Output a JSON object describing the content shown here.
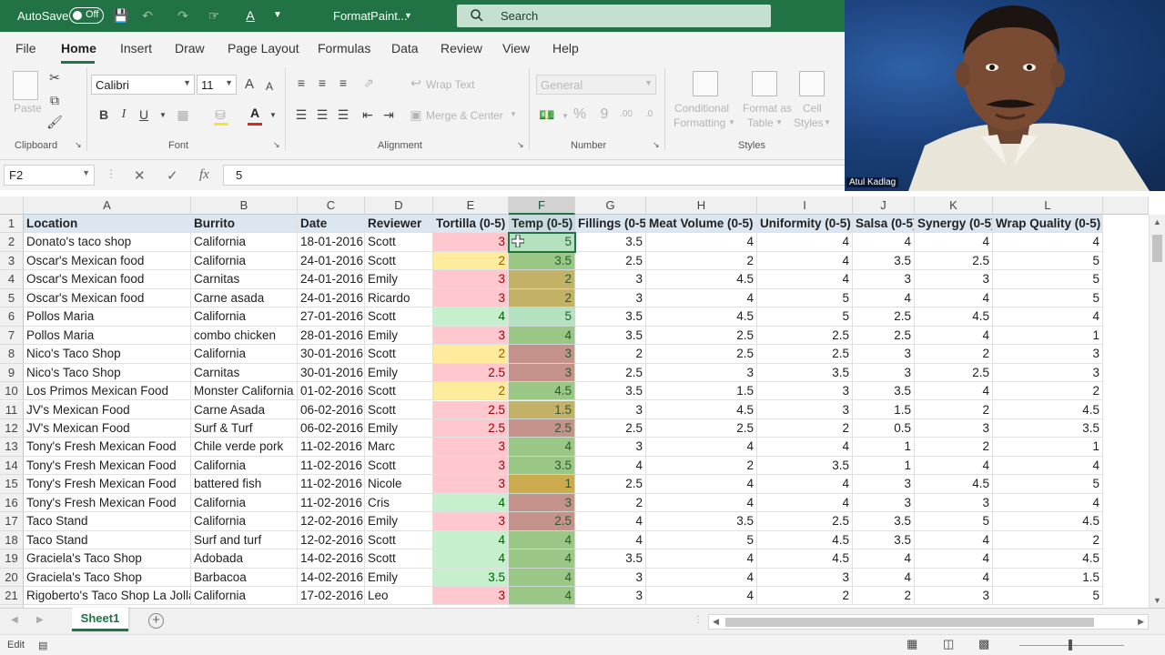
{
  "titlebar": {
    "autosave_label": "AutoSave",
    "autosave_state": "Off",
    "filename": "FormatPaint...",
    "search_placeholder": "Search"
  },
  "menu": [
    "File",
    "Home",
    "Insert",
    "Draw",
    "Page Layout",
    "Formulas",
    "Data",
    "Review",
    "View",
    "Help"
  ],
  "ribbon": {
    "clipboard": {
      "paste": "Paste",
      "group": "Clipboard"
    },
    "font": {
      "name": "Calibri",
      "size": "11",
      "bold": "B",
      "italic": "I",
      "underline": "U",
      "group": "Font",
      "grow": "A",
      "shrink": "A"
    },
    "alignment": {
      "wrap": "Wrap Text",
      "merge": "Merge & Center",
      "group": "Alignment"
    },
    "number": {
      "format": "General",
      "group": "Number"
    },
    "styles": {
      "conditional_1": "Conditional",
      "conditional_2": "Formatting",
      "format_table_1": "Format as",
      "format_table_2": "Table",
      "cell_styles_1": "Cell",
      "cell_styles_2": "Styles",
      "group": "Styles"
    }
  },
  "formula_bar": {
    "name_box": "F2",
    "value": "5"
  },
  "columns": [
    "A",
    "B",
    "C",
    "D",
    "E",
    "F",
    "G",
    "H",
    "I",
    "J",
    "K",
    "L"
  ],
  "header_row": [
    "Location",
    "Burrito",
    "Date",
    "Reviewer",
    "Tortilla (0-5)",
    "Temp (0-5)",
    "Fillings (0-5)",
    "Meat Volume (0-5)",
    "Uniformity (0-5)",
    "Salsa (0-5)",
    "Synergy (0-5)",
    "Wrap Quality (0-5)"
  ],
  "rows": [
    [
      "2",
      "Donato's taco shop",
      "California",
      "18-01-2016",
      "Scott",
      "3",
      "5",
      "3.5",
      "4",
      "4",
      "4",
      "4",
      "4"
    ],
    [
      "3",
      "Oscar's Mexican food",
      "California",
      "24-01-2016",
      "Scott",
      "2",
      "3.5",
      "2.5",
      "2",
      "4",
      "3.5",
      "2.5",
      "5"
    ],
    [
      "4",
      "Oscar's Mexican food",
      "Carnitas",
      "24-01-2016",
      "Emily",
      "3",
      "2",
      "3",
      "4.5",
      "4",
      "3",
      "3",
      "5"
    ],
    [
      "5",
      "Oscar's Mexican food",
      "Carne asada",
      "24-01-2016",
      "Ricardo",
      "3",
      "2",
      "3",
      "4",
      "5",
      "4",
      "4",
      "5"
    ],
    [
      "6",
      "Pollos Maria",
      "California",
      "27-01-2016",
      "Scott",
      "4",
      "5",
      "3.5",
      "4.5",
      "5",
      "2.5",
      "4.5",
      "4"
    ],
    [
      "7",
      "Pollos Maria",
      "combo chicken",
      "28-01-2016",
      "Emily",
      "3",
      "4",
      "3.5",
      "2.5",
      "2.5",
      "2.5",
      "4",
      "1"
    ],
    [
      "8",
      "Nico's Taco Shop",
      "California",
      "30-01-2016",
      "Scott",
      "2",
      "3",
      "2",
      "2.5",
      "2.5",
      "3",
      "2",
      "3"
    ],
    [
      "9",
      "Nico's Taco Shop",
      "Carnitas",
      "30-01-2016",
      "Emily",
      "2.5",
      "3",
      "2.5",
      "3",
      "3.5",
      "3",
      "2.5",
      "3"
    ],
    [
      "10",
      "Los Primos Mexican Food",
      "Monster California",
      "01-02-2016",
      "Scott",
      "2",
      "4.5",
      "3.5",
      "1.5",
      "3",
      "3.5",
      "4",
      "2"
    ],
    [
      "11",
      "JV's Mexican Food",
      "Carne Asada",
      "06-02-2016",
      "Scott",
      "2.5",
      "1.5",
      "3",
      "4.5",
      "3",
      "1.5",
      "2",
      "4.5"
    ],
    [
      "12",
      "JV's Mexican Food",
      "Surf & Turf",
      "06-02-2016",
      "Emily",
      "2.5",
      "2.5",
      "2.5",
      "2.5",
      "2",
      "0.5",
      "3",
      "3.5"
    ],
    [
      "13",
      "Tony's Fresh Mexican Food",
      "Chile verde pork",
      "11-02-2016",
      "Marc",
      "3",
      "4",
      "3",
      "4",
      "4",
      "1",
      "2",
      "1"
    ],
    [
      "14",
      "Tony's Fresh Mexican Food",
      "California",
      "11-02-2016",
      "Scott",
      "3",
      "3.5",
      "4",
      "2",
      "3.5",
      "1",
      "4",
      "4"
    ],
    [
      "15",
      "Tony's Fresh Mexican Food",
      "battered fish",
      "11-02-2016",
      "Nicole",
      "3",
      "1",
      "2.5",
      "4",
      "4",
      "3",
      "4.5",
      "5"
    ],
    [
      "16",
      "Tony's Fresh Mexican Food",
      "California",
      "11-02-2016",
      "Cris",
      "4",
      "3",
      "2",
      "4",
      "4",
      "3",
      "3",
      "4"
    ],
    [
      "17",
      "Taco Stand",
      "California",
      "12-02-2016",
      "Emily",
      "3",
      "2.5",
      "4",
      "3.5",
      "2.5",
      "3.5",
      "5",
      "4.5"
    ],
    [
      "18",
      "Taco Stand",
      "Surf and turf",
      "12-02-2016",
      "Scott",
      "4",
      "4",
      "4",
      "5",
      "4.5",
      "3.5",
      "4",
      "2"
    ],
    [
      "19",
      "Graciela's Taco Shop",
      "Adobada",
      "14-02-2016",
      "Scott",
      "4",
      "4",
      "3.5",
      "4",
      "4.5",
      "4",
      "4",
      "4.5"
    ],
    [
      "20",
      "Graciela's Taco Shop",
      "Barbacoa",
      "14-02-2016",
      "Emily",
      "3.5",
      "4",
      "3",
      "4",
      "3",
      "4",
      "4",
      "1.5"
    ],
    [
      "21",
      "Rigoberto's Taco Shop La Jolla",
      "California",
      "17-02-2016",
      "Leo",
      "3",
      "4",
      "3",
      "4",
      "2",
      "2",
      "3",
      "5"
    ]
  ],
  "colors": {
    "tortilla": {
      "3": "#ffc7ce",
      "2": "#ffeb9c",
      "2.5": "#ffc7ce",
      "4": "#c6efce",
      "3.5": "#c6efce"
    },
    "temp": {
      "5": "#c6efce",
      "3.5": "#a9d08e",
      "2": "#d6b86b",
      "4": "#a9d08e",
      "3": "#d99694",
      "4.5": "#a9d08e",
      "1.5": "#d6b86b",
      "2.5": "#d99694",
      "1": "#e0b050"
    },
    "accent": "#217346"
  },
  "sheet": {
    "tab": "Sheet1"
  },
  "status": {
    "mode": "Edit"
  },
  "webcam": {
    "name": "Atul Kadlag"
  }
}
